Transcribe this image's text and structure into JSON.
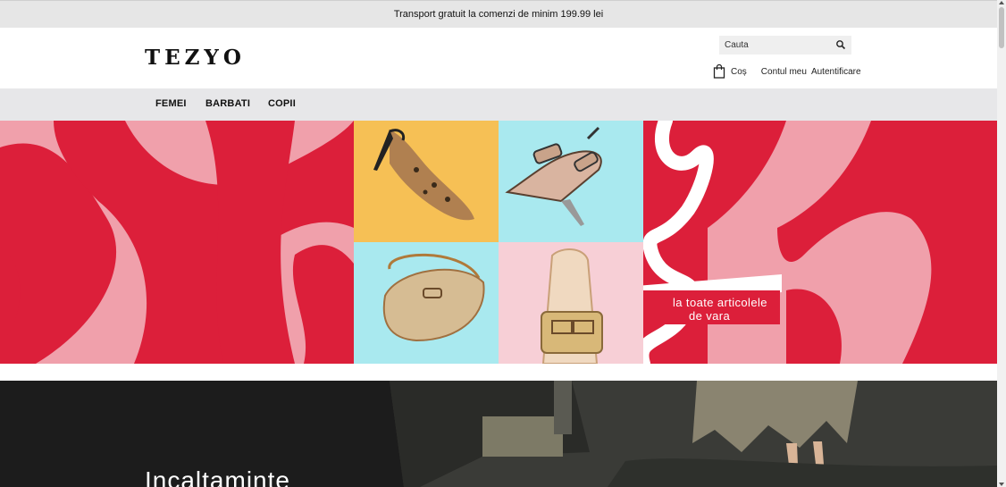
{
  "topbar": {
    "message": "Transport gratuit la comenzi de minim 199.99 lei"
  },
  "header": {
    "logo": "TEZYO",
    "search_placeholder": "Cauta",
    "cart_label": "Coș",
    "account_label": "Contul meu",
    "login_label": "Autentificare"
  },
  "nav": {
    "items": [
      "FEMEI",
      "BARBATI",
      "COPII"
    ]
  },
  "hero": {
    "text_line1": "la toate articolele",
    "text_line2": "de vara",
    "colors": {
      "red": "#dc1f3a",
      "pink": "#f0a0ab",
      "yellow": "#f6c055",
      "cyan": "#a9e9ef",
      "light_pink": "#f7cfd6"
    }
  },
  "section2": {
    "title": "Incaltaminte"
  }
}
